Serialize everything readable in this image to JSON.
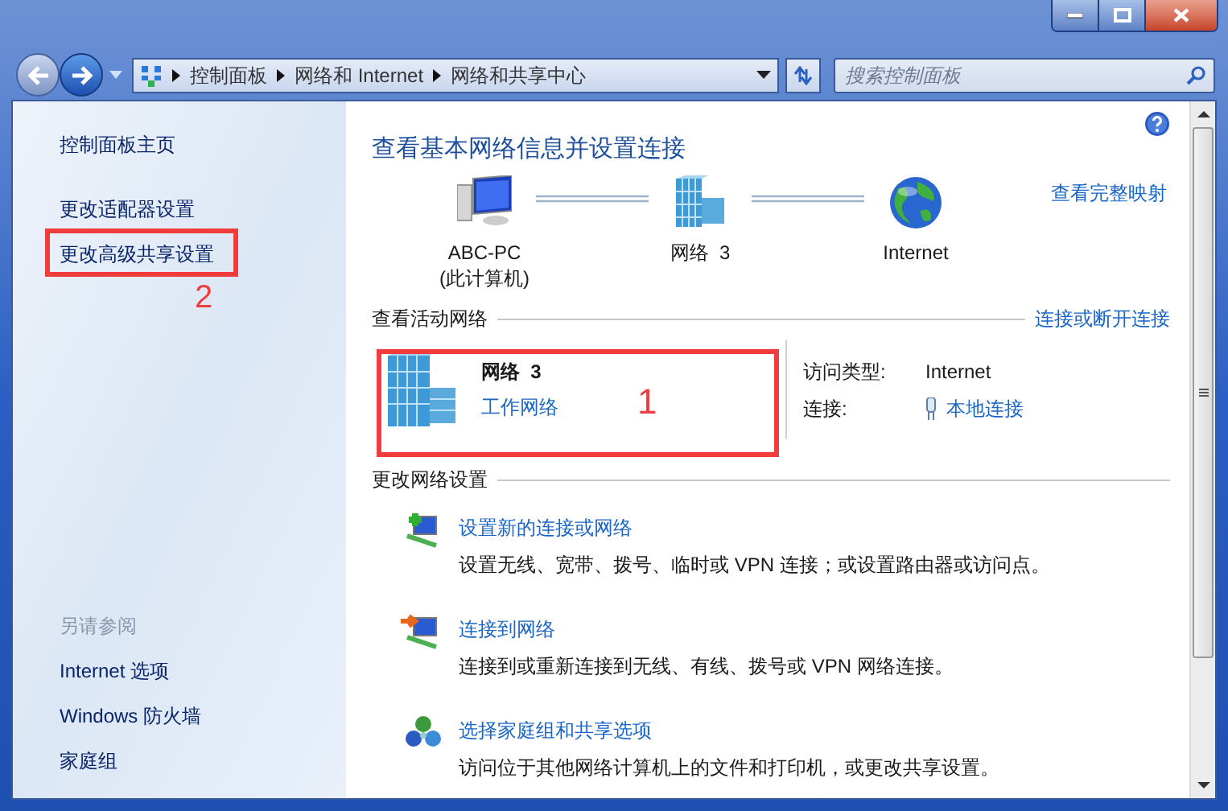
{
  "address_bar": {
    "breadcrumbs": [
      "控制面板",
      "网络和 Internet",
      "网络和共享中心"
    ]
  },
  "search": {
    "placeholder": "搜索控制面板"
  },
  "sidebar": {
    "items": [
      {
        "label": "控制面板主页"
      },
      {
        "label": "更改适配器设置"
      },
      {
        "label": "更改高级共享设置"
      }
    ],
    "see_also": {
      "title": "另请参阅",
      "items": [
        {
          "label": "Internet 选项"
        },
        {
          "label": "Windows 防火墙"
        },
        {
          "label": "家庭组"
        }
      ]
    }
  },
  "main": {
    "title": "查看基本网络信息并设置连接",
    "network_map": {
      "link": "查看完整映射",
      "nodes": [
        {
          "kind": "computer",
          "name": "ABC-PC",
          "subtitle": "(此计算机)"
        },
        {
          "kind": "network",
          "name": "网络  3"
        },
        {
          "kind": "internet",
          "name": "Internet"
        }
      ]
    },
    "active_networks": {
      "heading": "查看活动网络",
      "link": "连接或断开连接",
      "networks": [
        {
          "name": "网络  3",
          "type": "工作网络",
          "access_label": "访问类型:",
          "access_value": "Internet",
          "connection_label": "连接:",
          "connection_value": "本地连接"
        }
      ]
    },
    "change_settings": {
      "heading": "更改网络设置",
      "tasks": [
        {
          "kind": "new-connection",
          "title": "设置新的连接或网络",
          "description": "设置无线、宽带、拨号、临时或 VPN 连接；或设置路由器或访问点。"
        },
        {
          "kind": "connect",
          "title": "连接到网络",
          "description": "连接到或重新连接到无线、有线、拨号或 VPN 网络连接。"
        },
        {
          "kind": "homegroup",
          "title": "选择家庭组和共享选项",
          "description": "访问位于其他网络计算机上的文件和打印机，或更改共享设置。"
        }
      ]
    }
  },
  "annotations": [
    {
      "kind": "sidebar",
      "label": "2"
    },
    {
      "kind": "network",
      "label": "1"
    }
  ]
}
